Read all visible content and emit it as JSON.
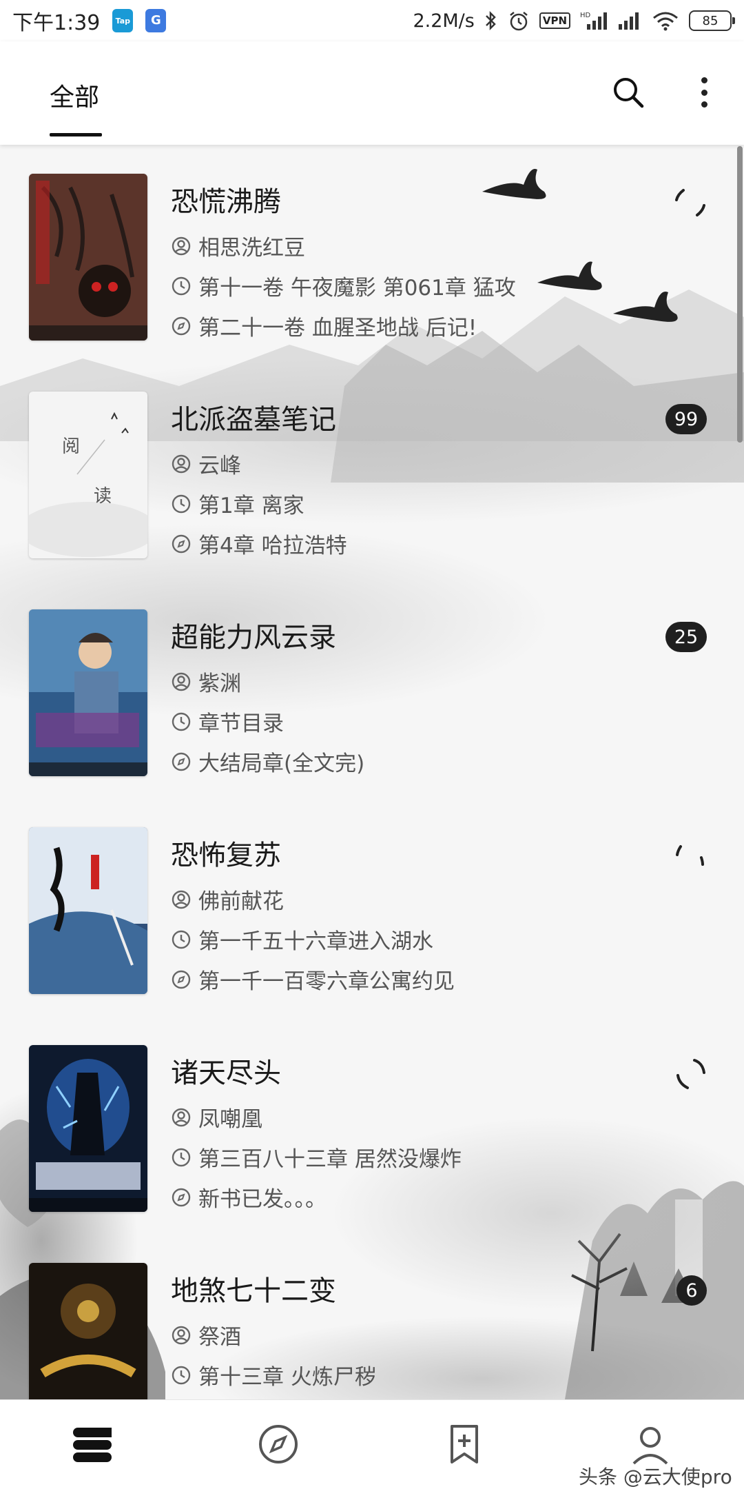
{
  "status_bar": {
    "time": "下午1:39",
    "app_badge_1": "Tap",
    "app_badge_2": "G",
    "net_speed": "2.2M/s",
    "vpn": "VPN",
    "battery": "85"
  },
  "header": {
    "tab_all": "全部"
  },
  "books": [
    {
      "title": "恐慌沸腾",
      "author": "相思洗红豆",
      "chapter": "第十一卷 午夜魔影 第061章 猛攻",
      "latest": "第二十一卷 血腥圣地战 后记!",
      "status": "loading"
    },
    {
      "title": "北派盗墓笔记",
      "author": "云峰",
      "chapter": "第1章 离家",
      "latest": "第4章 哈拉浩特",
      "badge": "99"
    },
    {
      "title": "超能力风云录",
      "author": "紫渊",
      "chapter": "章节目录",
      "latest": "大结局章(全文完)",
      "badge": "25"
    },
    {
      "title": "恐怖复苏",
      "author": "佛前献花",
      "chapter": "第一千五十六章进入湖水",
      "latest": "第一千一百零六章公寓约见",
      "status": "loading"
    },
    {
      "title": "诸天尽头",
      "author": "凤嘲凰",
      "chapter": "第三百八十三章 居然没爆炸",
      "latest": "新书已发。。。",
      "status": "loading"
    },
    {
      "title": "地煞七十二变",
      "author": "祭酒",
      "chapter": "第十三章 火炼尸秽",
      "badge": "6"
    }
  ],
  "covers": {
    "c2_text_1": "阅",
    "c2_text_2": "读"
  },
  "watermark": "头条 @云大使pro",
  "icons": {
    "search": "search-icon",
    "more": "more-vert-icon",
    "author": "person-circle-icon",
    "chapter": "clock-icon",
    "latest": "compass-icon",
    "nav_bookshelf": "bookshelf-icon",
    "nav_discover": "compass-icon",
    "nav_bookmark": "bookmark-add-icon",
    "nav_profile": "person-icon"
  }
}
